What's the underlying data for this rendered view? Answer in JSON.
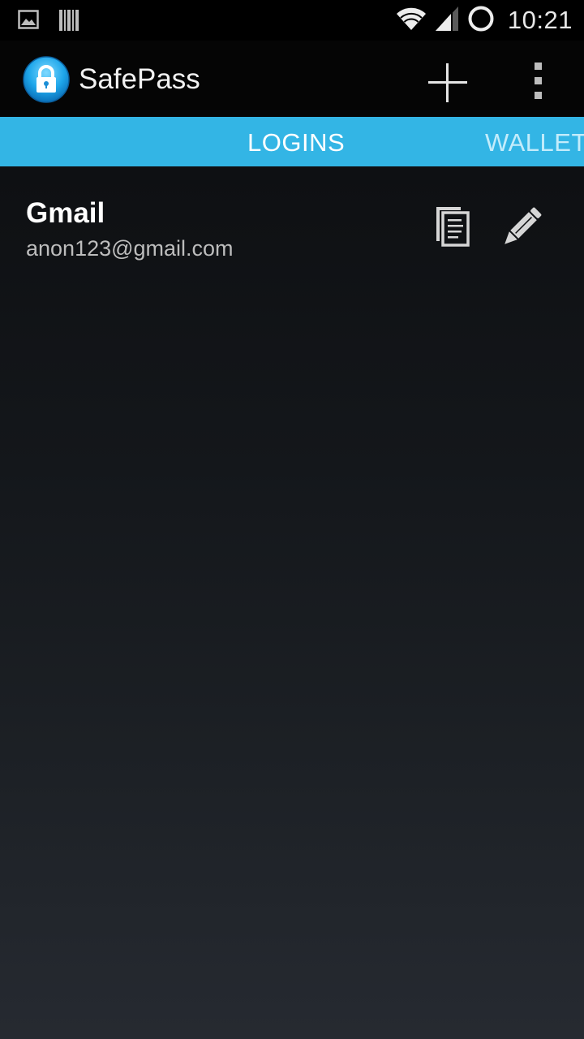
{
  "status_bar": {
    "time": "10:21",
    "icons": [
      "image-notification-icon",
      "barcode-notification-icon",
      "wifi-icon",
      "signal-icon",
      "sync-circle-icon"
    ]
  },
  "action_bar": {
    "title": "SafePass",
    "logo": "lock-logo-icon",
    "actions": [
      "add-icon",
      "overflow-menu-icon"
    ]
  },
  "tabs": [
    {
      "label": "LOGINS",
      "selected": true
    },
    {
      "label": "WALLET",
      "selected": false
    }
  ],
  "entries": [
    {
      "title": "Gmail",
      "subtitle": "anon123@gmail.com",
      "actions": [
        "copy-icon",
        "edit-pencil-icon"
      ]
    }
  ],
  "colors": {
    "accent": "#33b5e5",
    "background": "#0b0c0e",
    "text_primary": "#ffffff",
    "text_secondary": "#bdbdbd"
  }
}
